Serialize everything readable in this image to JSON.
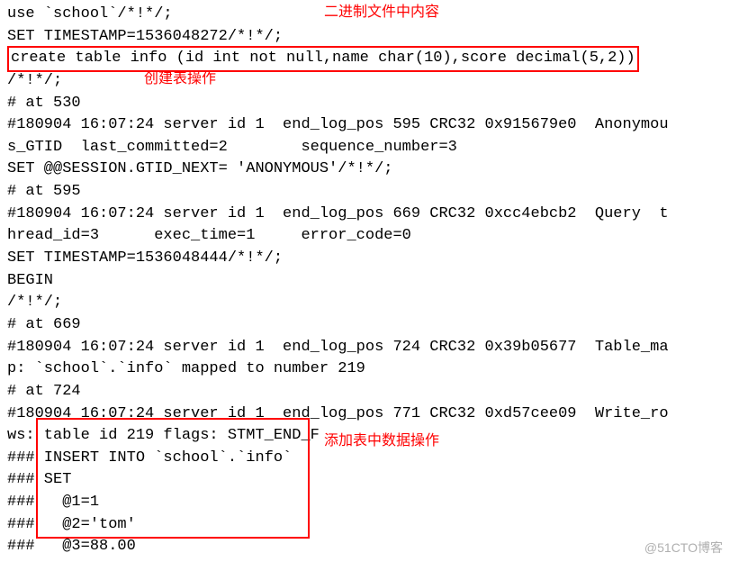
{
  "annotations": {
    "title": "二进制文件中内容",
    "create_op": "创建表操作",
    "insert_op": "添加表中数据操作"
  },
  "lines": {
    "l01": "use `school`/*!*/;",
    "l02": "SET TIMESTAMP=1536048272/*!*/;",
    "l03": "create table info (id int not null,name char(10),score decimal(5,2))",
    "l04": "/*!*/;",
    "l05": "# at 530",
    "l06": "#180904 16:07:24 server id 1  end_log_pos 595 CRC32 0x915679e0  Anonymou",
    "l07": "s_GTID  last_committed=2        sequence_number=3",
    "l08": "SET @@SESSION.GTID_NEXT= 'ANONYMOUS'/*!*/;",
    "l09": "# at 595",
    "l10": "#180904 16:07:24 server id 1  end_log_pos 669 CRC32 0xcc4ebcb2  Query  t",
    "l11": "hread_id=3      exec_time=1     error_code=0",
    "l12": "SET TIMESTAMP=1536048444/*!*/;",
    "l13": "BEGIN",
    "l14": "/*!*/;",
    "l15": "# at 669",
    "l16": "#180904 16:07:24 server id 1  end_log_pos 724 CRC32 0x39b05677  Table_ma",
    "l17": "p: `school`.`info` mapped to number 219",
    "l18": "# at 724",
    "l19": "#180904 16:07:24 server id 1  end_log_pos 771 CRC32 0xd57cee09  Write_ro",
    "l20": "ws: table id 219 flags: STMT_END_F",
    "l21": "### INSERT INTO `school`.`info`",
    "l22": "### SET",
    "l23": "###   @1=1",
    "l24": "###   @2='tom'",
    "l25": "###   @3=88.00"
  },
  "watermark": "@51CTO博客"
}
